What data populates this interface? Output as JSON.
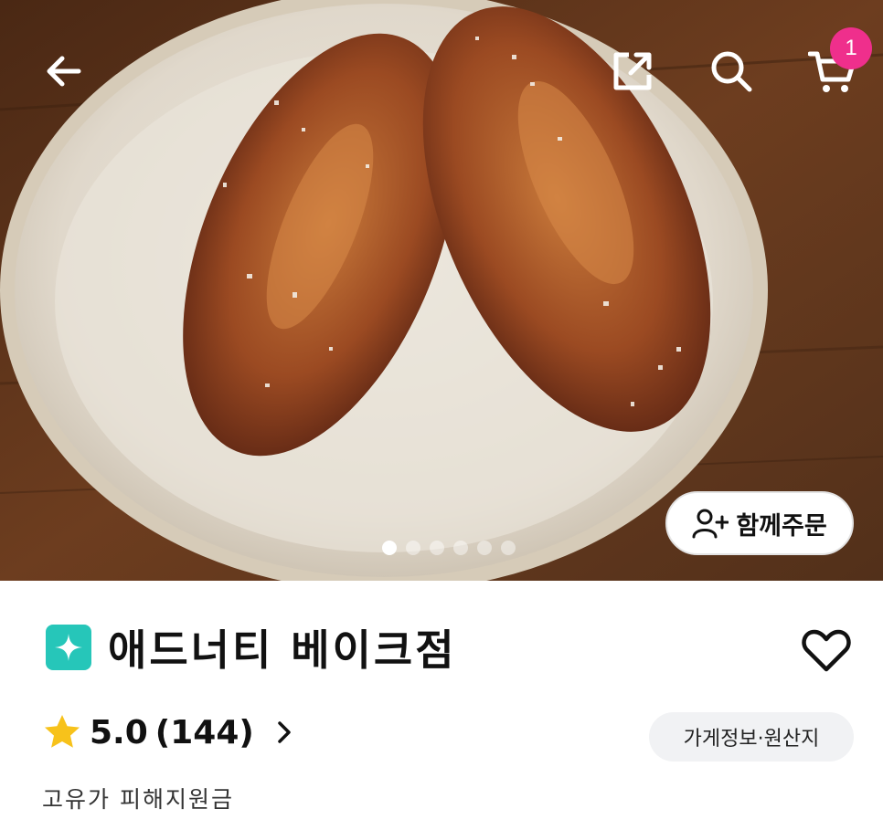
{
  "header": {
    "cart_count": "1"
  },
  "hero": {
    "carousel_total": 6,
    "carousel_active": 1,
    "group_order_label": "함께주문"
  },
  "store": {
    "name": "애드너티 베이크점",
    "rating": "5.0",
    "review_count": "(144)",
    "info_button_label": "가게정보·원산지",
    "support_label": "고유가 피해지원금"
  },
  "colors": {
    "badge_pink": "#ef2f8c",
    "store_badge_teal": "#26c6b9",
    "star_yellow": "#f7c21b"
  },
  "icons": [
    "back-arrow-icon",
    "share-icon",
    "search-icon",
    "cart-icon",
    "add-user-icon",
    "sparkle-icon",
    "heart-icon",
    "star-icon",
    "chevron-right-icon"
  ]
}
